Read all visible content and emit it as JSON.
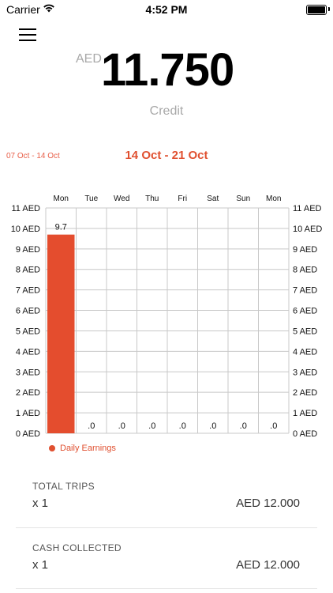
{
  "status_bar": {
    "carrier": "Carrier",
    "time": "4:52 PM"
  },
  "balance": {
    "currency": "AED",
    "amount": "11.750",
    "label": "Credit"
  },
  "week_nav": {
    "previous": "07 Oct - 14 Oct",
    "current": "14 Oct - 21 Oct"
  },
  "chart_data": {
    "type": "bar",
    "categories": [
      "Mon",
      "Tue",
      "Wed",
      "Thu",
      "Fri",
      "Sat",
      "Sun",
      "Mon"
    ],
    "series": [
      {
        "name": "Daily Earnings",
        "values": [
          9.7,
          0,
          0,
          0,
          0,
          0,
          0,
          0
        ]
      }
    ],
    "value_labels": [
      "9.7",
      ".0",
      ".0",
      ".0",
      ".0",
      ".0",
      ".0",
      ".0"
    ],
    "ylim": [
      0,
      11
    ],
    "y_ticks": [
      "0 AED",
      "1 AED",
      "2 AED",
      "3 AED",
      "4 AED",
      "5 AED",
      "6 AED",
      "7 AED",
      "8 AED",
      "9 AED",
      "10 AED",
      "11 AED"
    ],
    "bar_color": "#e44d2e",
    "grid": true,
    "legend_position": "bottom-left"
  },
  "summary": [
    {
      "title": "TOTAL TRIPS",
      "count": "x  1",
      "amount": "AED 12.000"
    },
    {
      "title": "CASH COLLECTED",
      "count": "x  1",
      "amount": "AED 12.000"
    }
  ]
}
